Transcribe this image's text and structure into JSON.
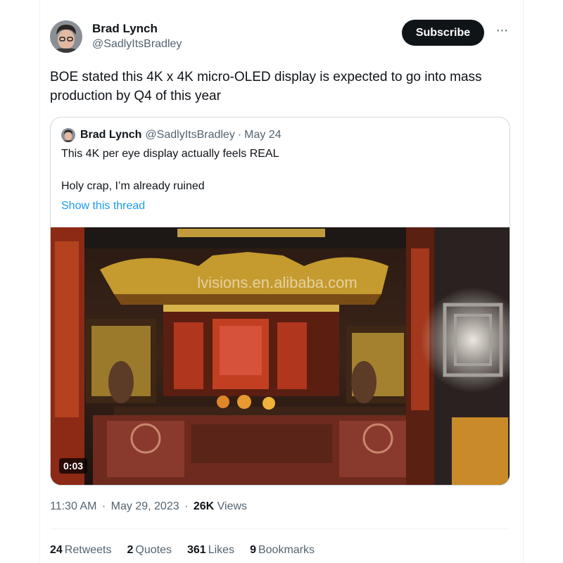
{
  "author": {
    "name": "Brad Lynch",
    "handle": "@SadlyItsBradley"
  },
  "actions": {
    "subscribe_label": "Subscribe",
    "more_label": "···"
  },
  "tweet": {
    "text": "BOE stated this 4K x 4K micro-OLED display is expected to go into mass production by Q4 of this year"
  },
  "quote": {
    "name": "Brad Lynch",
    "handle": "@SadlyItsBradley",
    "separator": "·",
    "date": "May 24",
    "line1": "This 4K per eye display actually feels REAL",
    "line2": "Holy crap, I’m already ruined",
    "link": "Show this thread",
    "watermark": "lvisions.en.alibaba.com",
    "video_duration": "0:03"
  },
  "meta": {
    "time": "11:30 AM",
    "separator": "·",
    "date": "May 29, 2023",
    "views_count": "26K",
    "views_label": "Views"
  },
  "stats": [
    {
      "count": "24",
      "label": "Retweets"
    },
    {
      "count": "2",
      "label": "Quotes"
    },
    {
      "count": "361",
      "label": "Likes"
    },
    {
      "count": "9",
      "label": "Bookmarks"
    }
  ],
  "colors": {
    "text": "#0f1419",
    "secondary": "#536471",
    "link": "#1d9bf0",
    "border": "#cfd9de"
  }
}
